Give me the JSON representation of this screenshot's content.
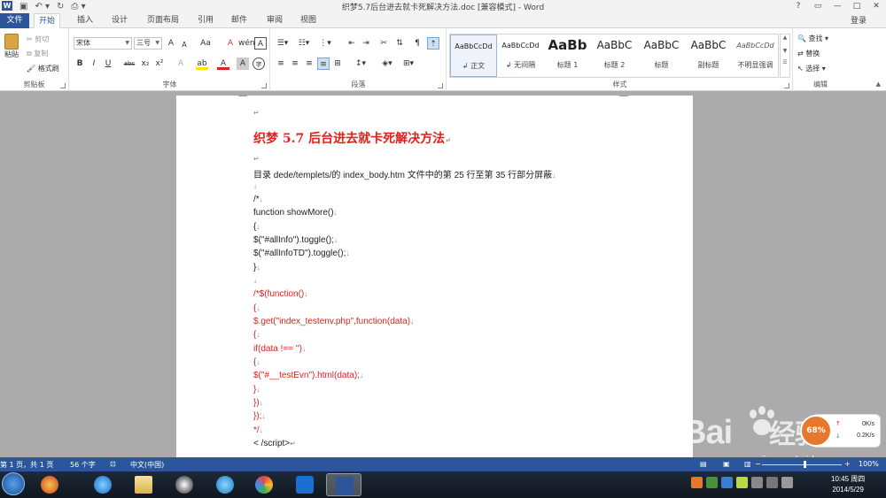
{
  "window": {
    "title": "织梦5.7后台进去就卡死解决方法.doc [兼容模式] - Word",
    "app_icon": "W",
    "controls": [
      "?",
      "▭",
      "—",
      "□",
      "✕"
    ]
  },
  "tabs": {
    "file": "文件",
    "items": [
      "开始",
      "插入",
      "设计",
      "页面布局",
      "引用",
      "邮件",
      "审阅",
      "视图"
    ],
    "login": "登录"
  },
  "ribbon": {
    "clipboard": {
      "label": "剪贴板",
      "paste": "粘贴",
      "cut": "剪切",
      "copy": "复制",
      "format_painter": "格式刷"
    },
    "font": {
      "label": "字体",
      "font_name": "宋体",
      "font_size": "三号",
      "grow": "A",
      "shrink": "A",
      "case": "Aa",
      "clear": "A",
      "border": "A",
      "bold": "B",
      "italic": "I",
      "underline": "U",
      "strike": "abc",
      "sub": "x₂",
      "sup": "x²",
      "effects": "A",
      "highlight": "ab",
      "color": "A",
      "shade": "A",
      "circle": "字"
    },
    "paragraph": {
      "label": "段落"
    },
    "styles": {
      "label": "样式",
      "items": [
        {
          "preview": "AaBbCcDd",
          "name": "↲ 正文"
        },
        {
          "preview": "AaBbCcDd",
          "name": "↲ 无间隔"
        },
        {
          "preview": "AaBb",
          "name": "标题 1"
        },
        {
          "preview": "AaBbC",
          "name": "标题 2"
        },
        {
          "preview": "AaBbC",
          "name": "标题"
        },
        {
          "preview": "AaBbC",
          "name": "副标题"
        },
        {
          "preview": "AaBbCcDd",
          "name": "不明显强调"
        }
      ]
    },
    "editing": {
      "label": "编辑",
      "find": "查找",
      "replace": "替换",
      "select": "选择"
    }
  },
  "document": {
    "lines": [
      {
        "text": "↵"
      },
      {
        "text": "织梦 5.7 后台进去就卡死解决方法",
        "mark": "↵"
      },
      {
        "text": "↵"
      },
      {
        "text": "目录 dede/templets/的 index_body.htm 文件中的第 25 行至第 35 行部分屏蔽",
        "mark": "↓"
      },
      {
        "text": "",
        "mark": "↓"
      },
      {
        "text": "/*",
        "mark": "↓"
      },
      {
        "text": "function showMore()",
        "mark": "↓"
      },
      {
        "text": "{",
        "mark": "↓"
      },
      {
        "text": "$(\"#allInfo\").toggle();",
        "mark": "↓"
      },
      {
        "text": "$(\"#allInfoTD\").toggle();",
        "mark": "↓"
      },
      {
        "text": "}",
        "mark": "↓"
      },
      {
        "text": "",
        "mark": "↓"
      },
      {
        "text": "/*$(function()",
        "mark": "↓"
      },
      {
        "text": "{",
        "mark": "↓"
      },
      {
        "text": "$.get(\"index_testenv.php\",function(data)",
        "mark": "↓"
      },
      {
        "text": "{",
        "mark": "↓"
      },
      {
        "text": "if(data !== '')",
        "mark": "↓"
      },
      {
        "text": "{",
        "mark": "↓"
      },
      {
        "text": "$(\"#__testEvn\").html(data);",
        "mark": "↓"
      },
      {
        "text": "}",
        "mark": "↓"
      },
      {
        "text": "})",
        "mark": "↓"
      },
      {
        "text": "});",
        "mark": "↓"
      },
      {
        "text": "*/",
        "mark": "↓"
      },
      {
        "text": "< /script>",
        "mark": "↵"
      }
    ]
  },
  "overlay": {
    "baidu": "Bai",
    "baidu2": "经验",
    "site": "jingyan.baidu.com",
    "speed_label": "68%",
    "up": "0K/s",
    "down": "0.2K/s"
  },
  "status": {
    "page": "第 1 页，共 1 页",
    "words": "56 个字",
    "lang": "中文(中国)",
    "zoom": "100%"
  },
  "clock": {
    "time": "10:45 周四",
    "date": "2014/5/29"
  },
  "colors": {
    "accent": "#2b579a",
    "text_red": "#e0201c"
  }
}
